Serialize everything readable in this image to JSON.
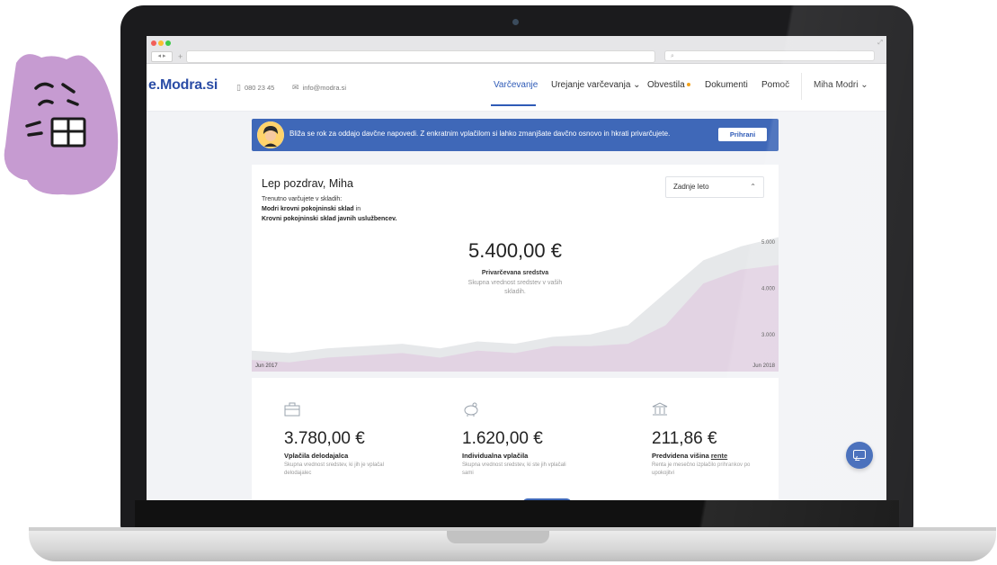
{
  "browser": {
    "nav_arrows": "◂ ▸",
    "new_tab_label": "+",
    "search_glyph": "⌕"
  },
  "header": {
    "logo": "e.Modra.si",
    "phone": "080 23 45",
    "email": "info@modra.si",
    "menu": [
      {
        "label": "Varčevanje",
        "active": true
      },
      {
        "label": "Urejanje varčevanja ⌄",
        "active": false
      },
      {
        "label": "Obvestila",
        "active": false,
        "badge_color": "#f4a31c"
      },
      {
        "label": "Dokumenti",
        "active": false
      },
      {
        "label": "Pomoč",
        "active": false
      }
    ],
    "user": "Miha Modri ⌄"
  },
  "banner": {
    "text": "Bliža se rok za oddajo davčne napovedi. Z enkratnim vplačilom si lahko zmanjšate davčno osnovo in hkrati privarčujete.",
    "button": "Prihrani"
  },
  "summary": {
    "greeting": "Lep pozdrav, Miha",
    "intro": "Trenutno varčujete v skladih:",
    "fund1": "Modri krovni pokojninski sklad",
    "conj": "in",
    "fund2": "Krovni pokojninski sklad javnih uslužbencev.",
    "period_select": "Zadnje leto",
    "total": "5.400,00 €",
    "total_label": "Privarčevana sredstva",
    "total_desc": "Skupna vrednost sredstev v vaših skladih."
  },
  "chart_data": {
    "type": "area",
    "x_start_label": "Jun 2017",
    "x_end_label": "Jun 2018",
    "y_ticks": [
      "5.000",
      "4.000",
      "3.000"
    ],
    "ylim": [
      2200,
      5500
    ],
    "series": [
      {
        "values": [
          2650,
          2600,
          2700,
          2750,
          2800,
          2700,
          2850,
          2800,
          2950,
          3000,
          3200,
          3900,
          4600,
          4900,
          5100
        ],
        "color": "#e6e8ea"
      },
      {
        "values": [
          2450,
          2400,
          2500,
          2550,
          2600,
          2500,
          2650,
          2600,
          2750,
          2750,
          2800,
          3200,
          4100,
          4400,
          4500
        ],
        "color": "#e2d3e3"
      }
    ]
  },
  "stats": [
    {
      "icon": "briefcase-icon",
      "value": "3.780,00 €",
      "title": "Vplačila delodajalca",
      "desc": "Skupna vrednost sredstev, ki jih je vplačal delodajalec"
    },
    {
      "icon": "piggy-bank-icon",
      "value": "1.620,00 €",
      "title": "Individualna vplačila",
      "desc": "Skupna vrednost sredstev, ki ste jih vplačali sami"
    },
    {
      "icon": "bank-icon",
      "value": "211,86 €",
      "title": "Predvidena višina",
      "title_link": "rente",
      "desc": "Renta je mesečno izplačilo prihrankov po upokojitvi"
    }
  ],
  "colors": {
    "brand": "#2b4da6",
    "accent": "#3f68b8",
    "mascot": "#c69bd1"
  }
}
